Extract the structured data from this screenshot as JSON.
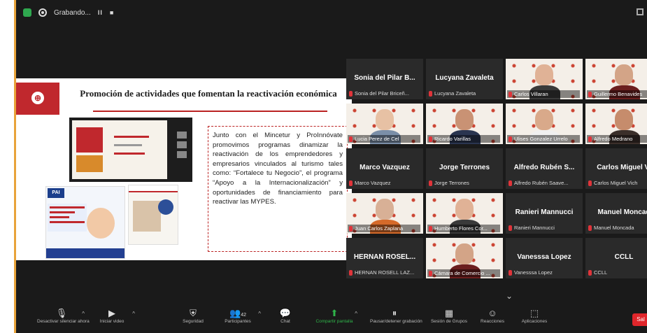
{
  "topbar": {
    "recording": "Grabando...",
    "pause": "II",
    "stop": "■"
  },
  "slide": {
    "title": "Promoción de actividades que fomentan la reactivación económica",
    "logo_mark": "⊕",
    "flyer_badge": "PAI",
    "body": "Junto con el Mincetur y ProInnóvate promovimos programas dinamizar la reactivación de los emprendedores y empresarios vinculados al turismo tales como: “Fortalece tu Negocio”, el programa “Apoyo a la Internacionalización” y oportunidades de financiamiento para reactivar las MYPES."
  },
  "participants": [
    {
      "display": "Sonia del Pilar B...",
      "caption": "Sonia del Pilar Briceñ...",
      "video": false
    },
    {
      "display": "Lucyana Zavaleta",
      "caption": "Lucyana Zavaleta",
      "video": false
    },
    {
      "display": "",
      "caption": "Carlos Villaran",
      "video": true
    },
    {
      "display": "",
      "caption": "Guillermo Benavides",
      "video": true,
      "active": true
    },
    {
      "display": "",
      "caption": "Lucia Perez de Cel",
      "video": true
    },
    {
      "display": "",
      "caption": "Ricardo Varillas",
      "video": true
    },
    {
      "display": "",
      "caption": "Ulises Gonzalez Urrelo",
      "video": true
    },
    {
      "display": "",
      "caption": "Alfredo Medrano",
      "video": true
    },
    {
      "display": "Marco Vazquez",
      "caption": "Marco Vazquez",
      "video": false
    },
    {
      "display": "Jorge Terrones",
      "caption": "Jorge Terrones",
      "video": false
    },
    {
      "display": "Alfredo Rubén S...",
      "caption": "Alfredo Rubén Saave...",
      "video": false
    },
    {
      "display": "Carlos Miguel Vi",
      "caption": "Carlos Miguel Vich",
      "video": false
    },
    {
      "display": "",
      "caption": "Juan Carlos Zaplana",
      "video": true
    },
    {
      "display": "",
      "caption": "Humberto Flores Cor...",
      "video": true
    },
    {
      "display": "Ranieri Mannucci",
      "caption": "Ranieri Mannucci",
      "video": false
    },
    {
      "display": "Manuel Moncad",
      "caption": "Manuel Moncada",
      "video": false
    },
    {
      "display": "HERNAN ROSEL...",
      "caption": "HERNAN ROSELL LAZ...",
      "video": false
    },
    {
      "display": "",
      "caption": "Cámara de Comercio ...",
      "video": true
    },
    {
      "display": "Vanesssa Lopez",
      "caption": "Vanesssa Lopez",
      "video": false
    },
    {
      "display": "CCLL",
      "caption": "CCLL",
      "video": false
    }
  ],
  "toolbar": {
    "unmute": "Desactivar silenciar ahora",
    "video": "Iniciar video",
    "security": "Seguridad",
    "participants": "Participantes",
    "participants_count": "42",
    "chat": "Chat",
    "share": "Compartir pantalla",
    "pause_share": "Pausar/detener grabación",
    "breakout": "Sesión de Grupos",
    "reactions": "Reacciones",
    "apps": "Aplicaciones",
    "leave": "Sal"
  },
  "colors": {
    "accent": "#e8a33a",
    "brand_red": "#c0282d",
    "share_green": "#2fb44a",
    "active_speaker": "#ffd93a"
  }
}
